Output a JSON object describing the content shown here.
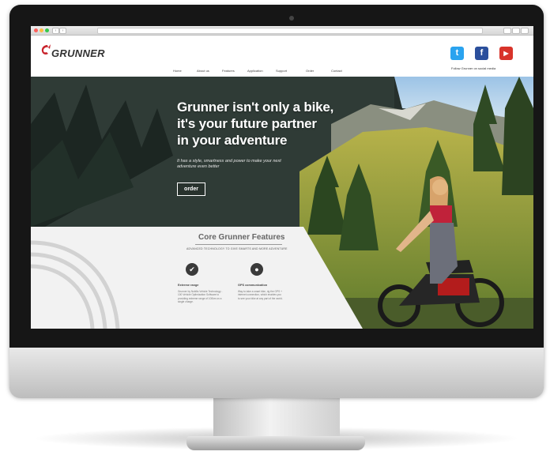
{
  "site": {
    "logo_text": "GRUNNER",
    "follow_text": "Follow Grunner on social media",
    "social": {
      "twitter_glyph": "t",
      "facebook_glyph": "f",
      "youtube_glyph": "▶"
    },
    "nav": [
      "Home",
      "About us",
      "Features",
      "Application",
      "Support",
      "Order",
      "Contact"
    ]
  },
  "hero": {
    "headline_lines": [
      "Grunner isn't only a bike,",
      "it's your future partner",
      "in your adventure"
    ],
    "tagline": "It has a style, smartness and power to make your next adventure even better",
    "order_label": "order"
  },
  "features": {
    "title": "Core Grunner Features",
    "subtitle": "ADVANCED TECHNOLOGY TO GIVE SMARTS AND MORE ADVENTURE",
    "items": [
      {
        "name": "Extreme range",
        "icon": "gauge-icon",
        "desc": "Grunner by Nobilis Vehicle Technology - 100 Vehicle Optimization Software to providing extreme range of 100km on a single charge."
      },
      {
        "name": "GPS communication",
        "icon": "location-pin-icon",
        "desc": "Way to take a smart bike, rig the GPS + internet connection, which enables you to see your bike at any part of the world."
      }
    ]
  },
  "colors": {
    "twitter": "#2aa3ef",
    "facebook": "#2b4f9c",
    "youtube": "#d8332a",
    "hero_dark": "#2e3a34",
    "logo_red": "#c8232c"
  }
}
